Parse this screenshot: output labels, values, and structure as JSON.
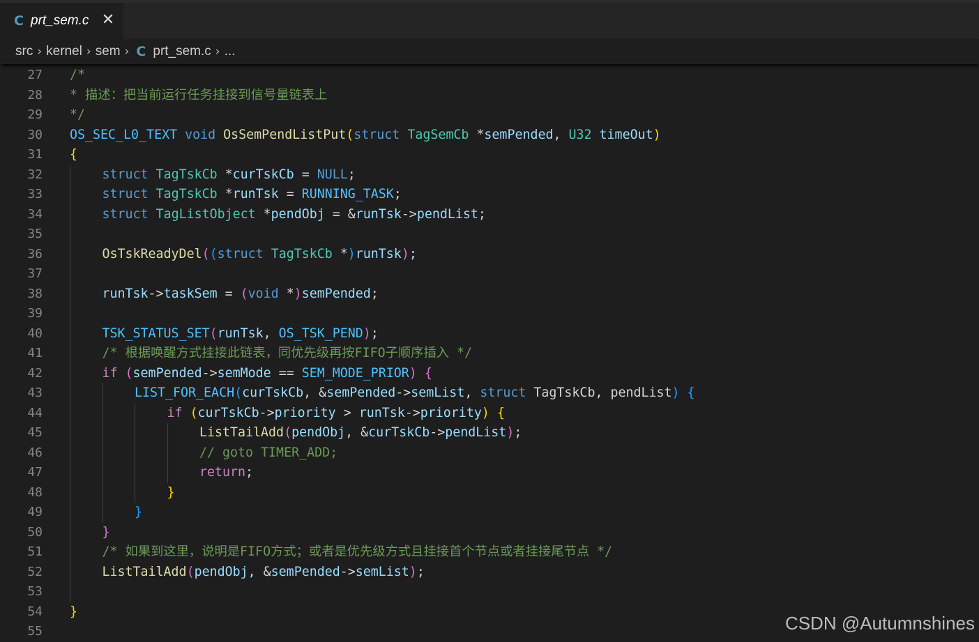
{
  "tab": {
    "icon": "c-language-icon",
    "label": "prt_sem.c",
    "close": "✕"
  },
  "breadcrumb": [
    "src",
    "kernel",
    "sem",
    "prt_sem.c",
    "..."
  ],
  "watermark": "CSDN @Autumnshines",
  "lines": [
    {
      "n": "27",
      "i": 0,
      "s": [
        [
          "c",
          "/*"
        ]
      ]
    },
    {
      "n": "28",
      "i": 0,
      "s": [
        [
          "c",
          "* 描述：把当前运行任务挂接到信号量链表上"
        ]
      ]
    },
    {
      "n": "29",
      "i": 0,
      "s": [
        [
          "c",
          "*/"
        ]
      ]
    },
    {
      "n": "30",
      "i": 0,
      "s": [
        [
          "m",
          "OS_SEC_L0_TEXT"
        ],
        [
          "o",
          " "
        ],
        [
          "k",
          "void"
        ],
        [
          "o",
          " "
        ],
        [
          "f",
          "OsSemPendListPut"
        ],
        [
          "b1",
          "("
        ],
        [
          "k",
          "struct"
        ],
        [
          "o",
          " "
        ],
        [
          "t",
          "TagSemCb"
        ],
        [
          "o",
          " *"
        ],
        [
          "v",
          "semPended"
        ],
        [
          "o",
          ", "
        ],
        [
          "t",
          "U32"
        ],
        [
          "o",
          " "
        ],
        [
          "v",
          "timeOut"
        ],
        [
          "b1",
          ")"
        ]
      ]
    },
    {
      "n": "31",
      "i": 0,
      "s": [
        [
          "b1",
          "{"
        ]
      ]
    },
    {
      "n": "32",
      "i": 1,
      "s": [
        [
          "k",
          "struct"
        ],
        [
          "o",
          " "
        ],
        [
          "t",
          "TagTskCb"
        ],
        [
          "o",
          " *"
        ],
        [
          "v",
          "curTskCb"
        ],
        [
          "o",
          " = "
        ],
        [
          "k",
          "NULL"
        ],
        [
          "o",
          ";"
        ]
      ]
    },
    {
      "n": "33",
      "i": 1,
      "s": [
        [
          "k",
          "struct"
        ],
        [
          "o",
          " "
        ],
        [
          "t",
          "TagTskCb"
        ],
        [
          "o",
          " *"
        ],
        [
          "v",
          "runTsk"
        ],
        [
          "o",
          " = "
        ],
        [
          "m",
          "RUNNING_TASK"
        ],
        [
          "o",
          ";"
        ]
      ]
    },
    {
      "n": "34",
      "i": 1,
      "s": [
        [
          "k",
          "struct"
        ],
        [
          "o",
          " "
        ],
        [
          "t",
          "TagListObject"
        ],
        [
          "o",
          " *"
        ],
        [
          "v",
          "pendObj"
        ],
        [
          "o",
          " = &"
        ],
        [
          "v",
          "runTsk"
        ],
        [
          "o",
          "->"
        ],
        [
          "v",
          "pendList"
        ],
        [
          "o",
          ";"
        ]
      ]
    },
    {
      "n": "35",
      "i": 1,
      "s": []
    },
    {
      "n": "36",
      "i": 1,
      "s": [
        [
          "f",
          "OsTskReadyDel"
        ],
        [
          "b2",
          "("
        ],
        [
          "b3",
          "("
        ],
        [
          "k",
          "struct"
        ],
        [
          "o",
          " "
        ],
        [
          "t",
          "TagTskCb"
        ],
        [
          "o",
          " *"
        ],
        [
          "b3",
          ")"
        ],
        [
          "v",
          "runTsk"
        ],
        [
          "b2",
          ")"
        ],
        [
          "o",
          ";"
        ]
      ]
    },
    {
      "n": "37",
      "i": 1,
      "s": []
    },
    {
      "n": "38",
      "i": 1,
      "s": [
        [
          "v",
          "runTsk"
        ],
        [
          "o",
          "->"
        ],
        [
          "v",
          "taskSem"
        ],
        [
          "o",
          " = "
        ],
        [
          "b2",
          "("
        ],
        [
          "k",
          "void"
        ],
        [
          "o",
          " *"
        ],
        [
          "b2",
          ")"
        ],
        [
          "v",
          "semPended"
        ],
        [
          "o",
          ";"
        ]
      ]
    },
    {
      "n": "39",
      "i": 1,
      "s": []
    },
    {
      "n": "40",
      "i": 1,
      "s": [
        [
          "m",
          "TSK_STATUS_SET"
        ],
        [
          "b2",
          "("
        ],
        [
          "v",
          "runTsk"
        ],
        [
          "o",
          ", "
        ],
        [
          "m",
          "OS_TSK_PEND"
        ],
        [
          "b2",
          ")"
        ],
        [
          "o",
          ";"
        ]
      ]
    },
    {
      "n": "41",
      "i": 1,
      "s": [
        [
          "c",
          "/* 根据唤醒方式挂接此链表，同优先级再按FIFO子顺序插入 */"
        ]
      ]
    },
    {
      "n": "42",
      "i": 1,
      "s": [
        [
          "p",
          "if"
        ],
        [
          "o",
          " "
        ],
        [
          "b2",
          "("
        ],
        [
          "v",
          "semPended"
        ],
        [
          "o",
          "->"
        ],
        [
          "v",
          "semMode"
        ],
        [
          "o",
          " == "
        ],
        [
          "m",
          "SEM_MODE_PRIOR"
        ],
        [
          "b2",
          ")"
        ],
        [
          "o",
          " "
        ],
        [
          "b2",
          "{"
        ]
      ]
    },
    {
      "n": "43",
      "i": 2,
      "s": [
        [
          "m",
          "LIST_FOR_EACH"
        ],
        [
          "b3",
          "("
        ],
        [
          "v",
          "curTskCb"
        ],
        [
          "o",
          ", &"
        ],
        [
          "v",
          "semPended"
        ],
        [
          "o",
          "->"
        ],
        [
          "v",
          "semList"
        ],
        [
          "o",
          ", "
        ],
        [
          "k",
          "struct"
        ],
        [
          "o",
          " TagTskCb, pendList"
        ],
        [
          "b3",
          ")"
        ],
        [
          "o",
          " "
        ],
        [
          "b3",
          "{"
        ]
      ]
    },
    {
      "n": "44",
      "i": 3,
      "s": [
        [
          "p",
          "if"
        ],
        [
          "o",
          " "
        ],
        [
          "b1",
          "("
        ],
        [
          "v",
          "curTskCb"
        ],
        [
          "o",
          "->"
        ],
        [
          "v",
          "priority"
        ],
        [
          "o",
          " > "
        ],
        [
          "v",
          "runTsk"
        ],
        [
          "o",
          "->"
        ],
        [
          "v",
          "priority"
        ],
        [
          "b1",
          ")"
        ],
        [
          "o",
          " "
        ],
        [
          "b1",
          "{"
        ]
      ]
    },
    {
      "n": "45",
      "i": 4,
      "s": [
        [
          "f",
          "ListTailAdd"
        ],
        [
          "b2",
          "("
        ],
        [
          "v",
          "pendObj"
        ],
        [
          "o",
          ", &"
        ],
        [
          "v",
          "curTskCb"
        ],
        [
          "o",
          "->"
        ],
        [
          "v",
          "pendList"
        ],
        [
          "b2",
          ")"
        ],
        [
          "o",
          ";"
        ]
      ]
    },
    {
      "n": "46",
      "i": 4,
      "s": [
        [
          "c",
          "// goto TIMER_ADD;"
        ]
      ]
    },
    {
      "n": "47",
      "i": 4,
      "s": [
        [
          "p",
          "return"
        ],
        [
          "o",
          ";"
        ]
      ]
    },
    {
      "n": "48",
      "i": 3,
      "s": [
        [
          "b1",
          "}"
        ]
      ]
    },
    {
      "n": "49",
      "i": 2,
      "s": [
        [
          "b3",
          "}"
        ]
      ]
    },
    {
      "n": "50",
      "i": 1,
      "s": [
        [
          "b2",
          "}"
        ]
      ]
    },
    {
      "n": "51",
      "i": 1,
      "s": [
        [
          "c",
          "/* 如果到这里，说明是FIFO方式；或者是优先级方式且挂接首个节点或者挂接尾节点 */"
        ]
      ]
    },
    {
      "n": "52",
      "i": 1,
      "s": [
        [
          "f",
          "ListTailAdd"
        ],
        [
          "b2",
          "("
        ],
        [
          "v",
          "pendObj"
        ],
        [
          "o",
          ", &"
        ],
        [
          "v",
          "semPended"
        ],
        [
          "o",
          "->"
        ],
        [
          "v",
          "semList"
        ],
        [
          "b2",
          ")"
        ],
        [
          "o",
          ";"
        ]
      ]
    },
    {
      "n": "53",
      "i": 1,
      "s": []
    },
    {
      "n": "54",
      "i": 0,
      "s": [
        [
          "b1",
          "}"
        ]
      ]
    },
    {
      "n": "55",
      "i": 0,
      "s": []
    }
  ]
}
